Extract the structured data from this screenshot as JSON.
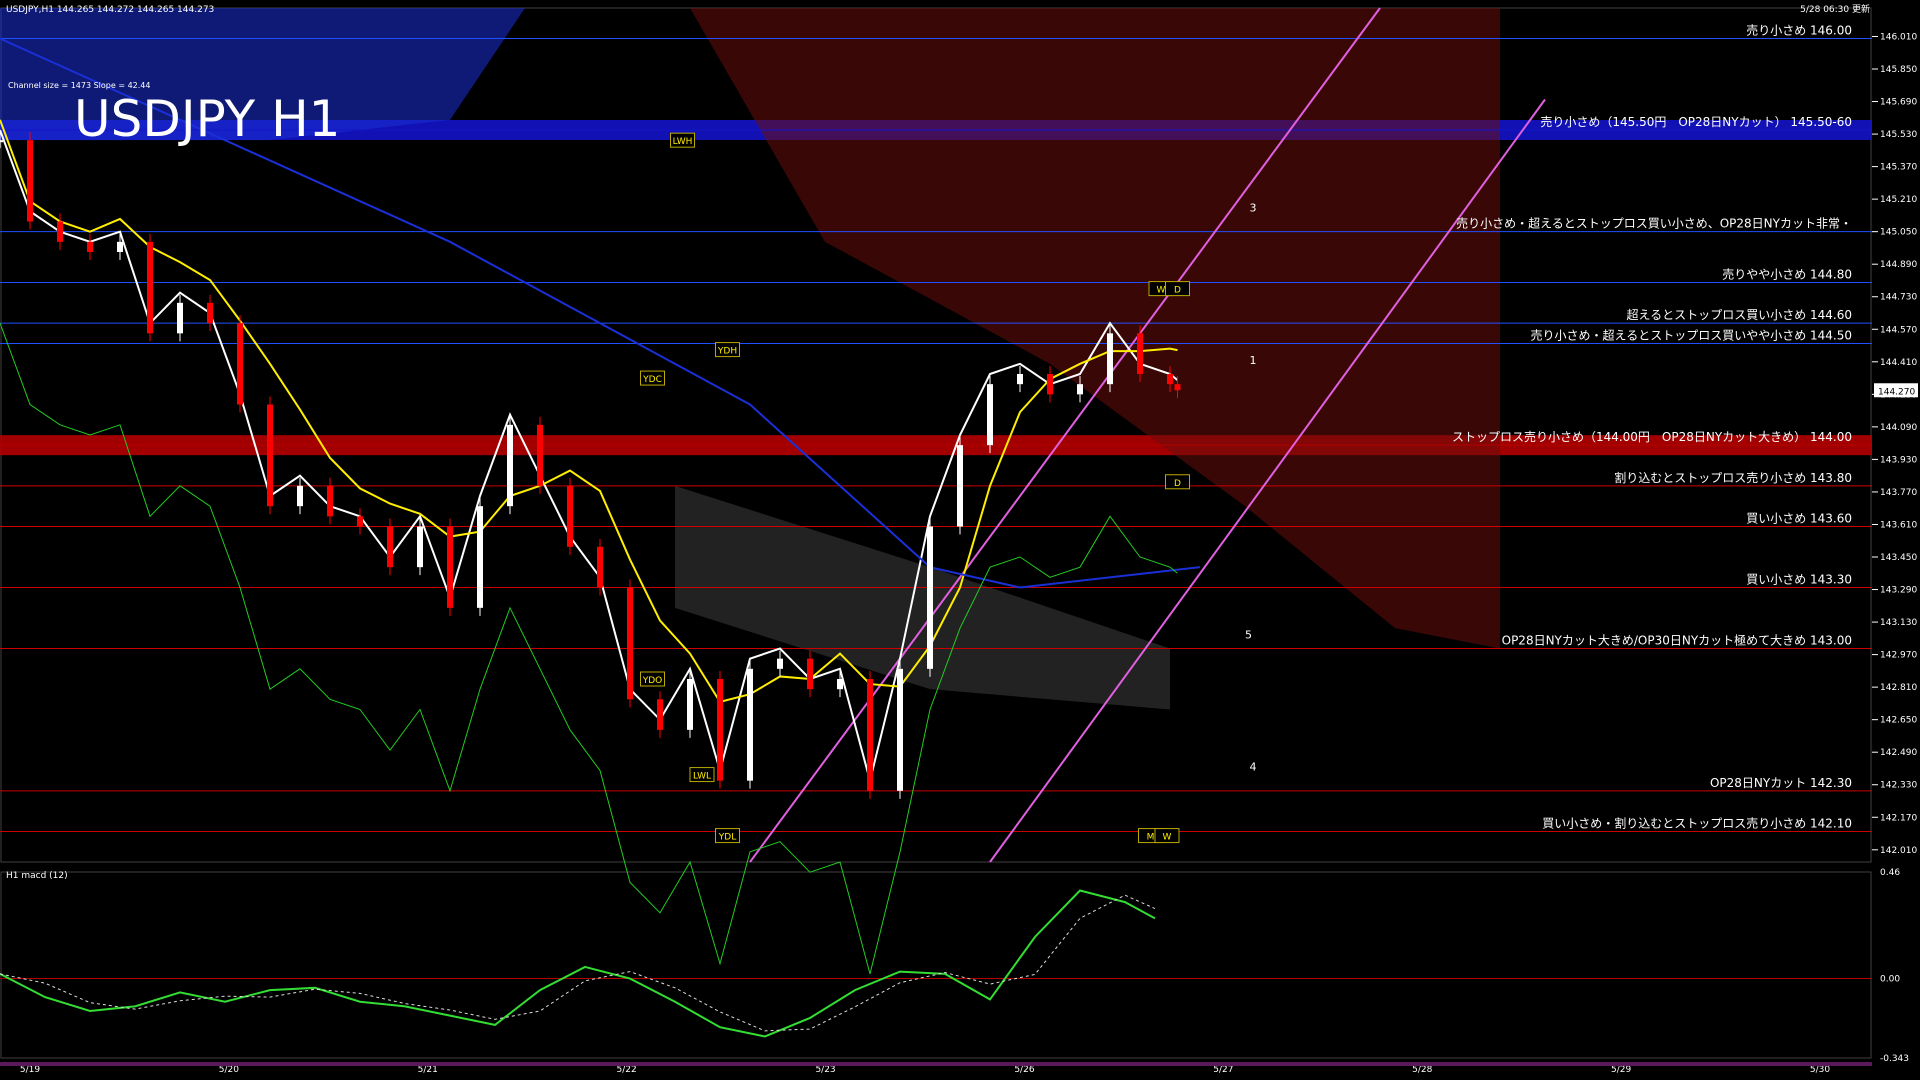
{
  "window": {
    "header_left": "USDJPY,H1  144.265 144.272 144.265 144.273",
    "header_right": "5/28 06:30 更新",
    "channel_info": "Channel size = 1473 Slope = 42.44",
    "big_title": "USDJPY H1",
    "macd_label": "H1 macd (12)"
  },
  "colors": {
    "background": "#000000",
    "bull_candle": "#ffffff",
    "bear_candle": "#ff0000",
    "ma_white": "#ffffff",
    "ma_yellow": "#ffee00",
    "ma_blue": "#1a2fd6",
    "channel": "#e060e0",
    "chikou": "#22cc22",
    "resistance_band": "#1414c8",
    "support_band": "#b40000",
    "grid": "#4a0000"
  },
  "price_levels": [
    {
      "price": 146.0,
      "label": "売り小さめ 146.00",
      "color": "#2050ff"
    },
    {
      "price": 145.55,
      "label": "売り小さめ（145.50円　OP28日NYカット） 145.50-60",
      "color": "#1414c8",
      "band": true
    },
    {
      "price": 145.05,
      "label": "売り小さめ・超えるとストップロス買い小さめ、OP28日NYカット非常・",
      "color": "#2050ff"
    },
    {
      "price": 144.8,
      "label": "売りやや小さめ 144.80",
      "color": "#2050ff"
    },
    {
      "price": 144.6,
      "label": "超えるとストップロス買い小さめ 144.60",
      "color": "#2050ff"
    },
    {
      "price": 144.5,
      "label": "売り小さめ・超えるとストップロス買いやや小さめ 144.50",
      "color": "#2050ff"
    },
    {
      "price": 144.0,
      "label": "ストップロス売り小さめ（144.00円　OP28日NYカット大きめ） 144.00",
      "color": "#b40000",
      "band": true
    },
    {
      "price": 143.8,
      "label": "割り込むとストップロス売り小さめ 143.80",
      "color": "#cc0000"
    },
    {
      "price": 143.6,
      "label": "買い小さめ 143.60",
      "color": "#cc0000"
    },
    {
      "price": 143.3,
      "label": "買い小さめ 143.30",
      "color": "#cc0000"
    },
    {
      "price": 143.0,
      "label": "OP28日NYカット大きめ/OP30日NYカット極めて大きめ 143.00",
      "color": "#cc0000"
    },
    {
      "price": 142.3,
      "label": "OP28日NYカット 142.30",
      "color": "#cc0000"
    },
    {
      "price": 142.1,
      "label": "買い小さめ・割り込むとストップロス売り小さめ 142.10",
      "color": "#cc0000"
    }
  ],
  "markers": [
    {
      "label": "LWH",
      "price": 145.5,
      "t": 0.455
    },
    {
      "label": "YDH",
      "price": 144.47,
      "t": 0.485
    },
    {
      "label": "YDC",
      "price": 144.33,
      "t": 0.435
    },
    {
      "label": "YDO",
      "price": 142.85,
      "t": 0.435
    },
    {
      "label": "LWL",
      "price": 142.38,
      "t": 0.468
    },
    {
      "label": "YDL",
      "price": 142.08,
      "t": 0.485
    },
    {
      "label": "W",
      "price": 144.77,
      "t": 0.774
    },
    {
      "label": "D",
      "price": 144.77,
      "t": 0.785
    },
    {
      "label": "D",
      "price": 143.82,
      "t": 0.785
    },
    {
      "label": "M",
      "price": 142.08,
      "t": 0.767
    },
    {
      "label": "W",
      "price": 142.08,
      "t": 0.778
    }
  ],
  "wave_labels": [
    {
      "label": "1",
      "price": 144.4,
      "t": 0.833
    },
    {
      "label": "3",
      "price": 145.15,
      "t": 0.833
    },
    {
      "label": "4",
      "price": 142.4,
      "t": 0.833
    },
    {
      "label": "5",
      "price": 143.05,
      "t": 0.83
    }
  ],
  "chart_data": {
    "type": "line",
    "title": "USDJPY H1",
    "symbol": "USDJPY",
    "timeframe": "H1",
    "ylim": [
      141.95,
      146.15
    ],
    "y_tick_labels": [
      "146.010",
      "145.850",
      "145.690",
      "145.530",
      "145.370",
      "145.210",
      "145.050",
      "144.890",
      "144.730",
      "144.570",
      "144.410",
      "144.250",
      "144.090",
      "143.930",
      "143.770",
      "143.610",
      "143.450",
      "143.290",
      "143.130",
      "142.970",
      "142.810",
      "142.650",
      "142.490",
      "142.330",
      "142.170",
      "142.010"
    ],
    "current_price": "144.270",
    "x_date_labels": [
      "5/19",
      "5/20",
      "5/21",
      "5/22",
      "5/23",
      "5/26",
      "5/27",
      "5/28",
      "5/29",
      "5/30"
    ],
    "close_series": {
      "name": "",
      "t": [
        0.0,
        0.02,
        0.04,
        0.06,
        0.08,
        0.1,
        0.12,
        0.14,
        0.16,
        0.18,
        0.2,
        0.22,
        0.24,
        0.26,
        0.28,
        0.3,
        0.32,
        0.34,
        0.36,
        0.38,
        0.4,
        0.42,
        0.44,
        0.46,
        0.48,
        0.5,
        0.52,
        0.54,
        0.56,
        0.58,
        0.6,
        0.62,
        0.64,
        0.66,
        0.68,
        0.7,
        0.72,
        0.74,
        0.76,
        0.78,
        0.785
      ],
      "values": [
        145.5,
        145.1,
        145.0,
        144.95,
        145.0,
        144.55,
        144.7,
        144.6,
        144.2,
        143.7,
        143.8,
        143.65,
        143.6,
        143.4,
        143.6,
        143.2,
        143.7,
        144.1,
        143.8,
        143.5,
        143.3,
        142.75,
        142.6,
        142.85,
        142.35,
        142.9,
        142.95,
        142.8,
        142.85,
        142.3,
        142.9,
        143.6,
        144.0,
        144.3,
        144.35,
        144.25,
        144.3,
        144.55,
        144.35,
        144.3,
        144.27
      ]
    },
    "macd": {
      "ylim": [
        -0.343,
        0.46
      ],
      "tick_labels": [
        "0.46",
        "0.00",
        "-0.343"
      ],
      "t": [
        0.0,
        0.03,
        0.06,
        0.09,
        0.12,
        0.15,
        0.18,
        0.21,
        0.24,
        0.27,
        0.3,
        0.33,
        0.36,
        0.39,
        0.42,
        0.45,
        0.48,
        0.51,
        0.54,
        0.57,
        0.6,
        0.63,
        0.66,
        0.69,
        0.72,
        0.75,
        0.77
      ],
      "values": [
        0.02,
        -0.08,
        -0.14,
        -0.12,
        -0.06,
        -0.1,
        -0.05,
        -0.04,
        -0.1,
        -0.12,
        -0.16,
        -0.2,
        -0.05,
        0.05,
        0.0,
        -0.1,
        -0.21,
        -0.25,
        -0.17,
        -0.05,
        0.03,
        0.02,
        -0.09,
        0.18,
        0.38,
        0.33,
        0.26
      ]
    }
  }
}
